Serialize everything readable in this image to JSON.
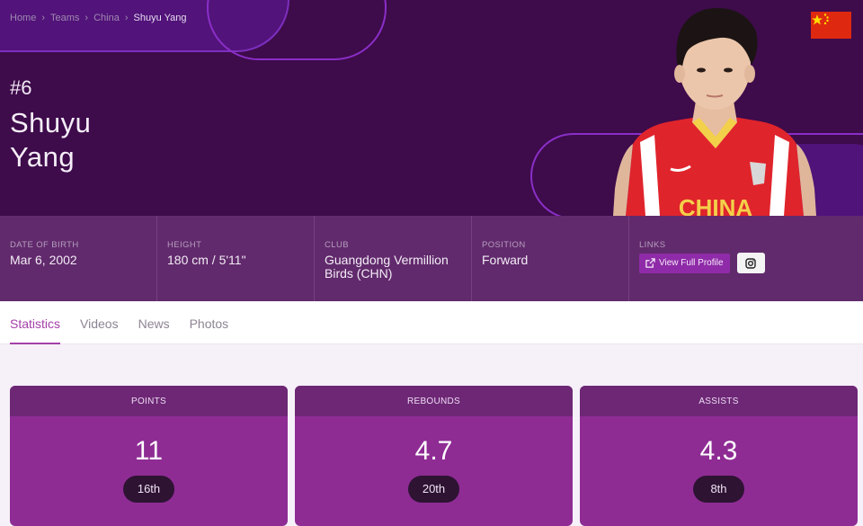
{
  "breadcrumb": {
    "items": [
      "Home",
      "Teams",
      "China"
    ],
    "current": "Shuyu Yang"
  },
  "player": {
    "number": "#6",
    "first_name": "Shuyu",
    "last_name": "Yang",
    "team_flag": "China flag"
  },
  "colors": {
    "hero_bg": "#3e0b4b",
    "info_bg": "#612a6c",
    "accent": "#a43fa8",
    "card_bg": "#8e2c94",
    "card_head": "#6d2775"
  },
  "info": {
    "dob_label": "DATE OF BIRTH",
    "dob_value": "Mar 6, 2002",
    "height_label": "HEIGHT",
    "height_value": "180 cm / 5'11\"",
    "club_label": "CLUB",
    "club_value": "Guangdong Vermillion Birds (CHN)",
    "position_label": "POSITION",
    "position_value": "Forward",
    "links_label": "LINKS",
    "profile_button": "View Full Profile",
    "external_icon": "external-link-icon",
    "instagram_icon": "instagram-icon"
  },
  "tabs": [
    "Statistics",
    "Videos",
    "News",
    "Photos"
  ],
  "stats": [
    {
      "label": "POINTS",
      "value": "11",
      "rank": "16th"
    },
    {
      "label": "REBOUNDS",
      "value": "4.7",
      "rank": "20th"
    },
    {
      "label": "ASSISTS",
      "value": "4.3",
      "rank": "8th"
    }
  ]
}
